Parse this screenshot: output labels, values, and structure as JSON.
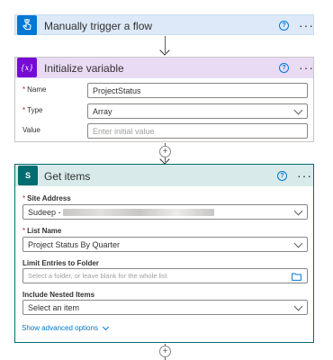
{
  "colors": {
    "trigger_bg": "#dde9f8",
    "trigger_icon": "#0078d4",
    "variable_bg": "#eadbf4",
    "variable_icon": "#770bd6",
    "sharepoint_bg": "#d8eaea",
    "sharepoint_icon": "#036c70",
    "sharepoint_border": "#036c70",
    "accent": "#0078d4",
    "required": "#a4262c"
  },
  "trigger": {
    "title": "Manually trigger a flow",
    "icon": "hand-touch-icon"
  },
  "init_variable": {
    "title": "Initialize variable",
    "icon": "variable-braces-icon",
    "icon_text": "{x}",
    "fields": {
      "name": {
        "label": "Name",
        "value": "ProjectStatus"
      },
      "type": {
        "label": "Type",
        "value": "Array"
      },
      "value": {
        "label": "Value",
        "placeholder": "Enter initial value"
      }
    }
  },
  "get_items": {
    "title": "Get items",
    "icon": "sharepoint-icon",
    "icon_text": "S",
    "fields": {
      "site_address": {
        "label": "Site Address",
        "value": "Sudeep - "
      },
      "list_name": {
        "label": "List Name",
        "value": "Project Status By Quarter"
      },
      "limit_folder": {
        "label": "Limit Entries to Folder",
        "placeholder": "Select a folder, or leave blank for the whole list"
      },
      "nested_items": {
        "label": "Include Nested Items",
        "value": "Select an item"
      }
    },
    "advanced_label": "Show advanced options"
  },
  "help_glyph": "?",
  "more_glyph": "···",
  "required_mark": "*",
  "plus_glyph": "+"
}
